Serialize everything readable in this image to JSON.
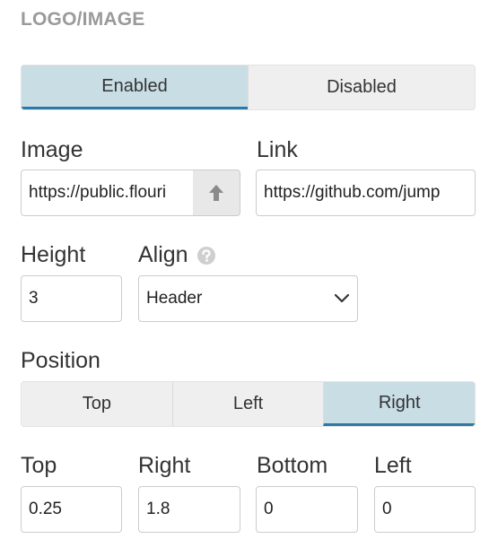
{
  "section": {
    "title": "LOGO/IMAGE"
  },
  "enabled_toggle": {
    "options": [
      "Enabled",
      "Disabled"
    ],
    "selected": "Enabled"
  },
  "image": {
    "label": "Image",
    "value": "https://public.flourish.studio/uploads/…",
    "shown_value": "https://public.flouri",
    "upload_icon": "upload-arrow-icon"
  },
  "link": {
    "label": "Link",
    "shown_value": "https://github.com/jump"
  },
  "height": {
    "label": "Height",
    "value": "3"
  },
  "align": {
    "label": "Align",
    "help_icon": "help-icon",
    "selected": "Header",
    "dropdown_icon": "chevron-down-icon"
  },
  "position": {
    "label": "Position",
    "options": [
      "Top",
      "Left",
      "Right"
    ],
    "selected": "Right"
  },
  "margins": {
    "top": {
      "label": "Top",
      "value": "0.25"
    },
    "right": {
      "label": "Right",
      "value": "1.8"
    },
    "bottom": {
      "label": "Bottom",
      "value": "0"
    },
    "left": {
      "label": "Left",
      "value": "0"
    }
  },
  "colors": {
    "active_bg": "#c9dde5",
    "active_border": "#2e78a6",
    "inactive_bg": "#efefef",
    "section_title": "#9a9a9a"
  }
}
